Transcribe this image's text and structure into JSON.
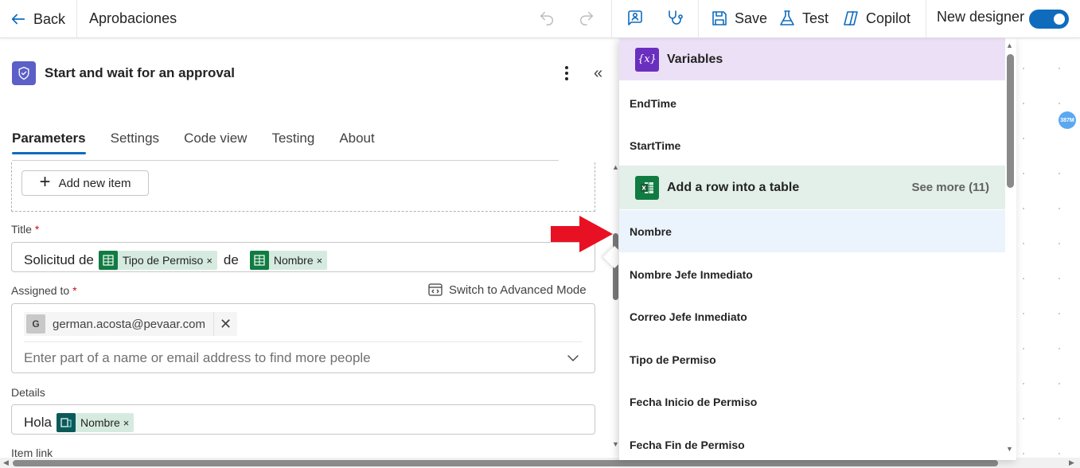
{
  "topbar": {
    "back_label": "Back",
    "flow_name": "Aprobaciones",
    "save_label": "Save",
    "test_label": "Test",
    "copilot_label": "Copilot",
    "new_designer_label": "New designer",
    "new_designer_on": true
  },
  "action": {
    "title": "Start and wait for an approval",
    "tabs": [
      {
        "label": "Parameters",
        "active": true
      },
      {
        "label": "Settings",
        "active": false
      },
      {
        "label": "Code view",
        "active": false
      },
      {
        "label": "Testing",
        "active": false
      },
      {
        "label": "About",
        "active": false
      }
    ],
    "add_item_label": "Add new item"
  },
  "fields": {
    "title_label": "Title",
    "required_mark": "*",
    "title_value": {
      "prefix": "Solicitud de",
      "token1": "Tipo de Permiso",
      "middle": "de",
      "token2": "Nombre"
    },
    "assigned_label": "Assigned to",
    "advanced_mode_label": "Switch to Advanced Mode",
    "assignee_initial": "G",
    "assignee_email": "german.acosta@pevaar.com",
    "people_placeholder": "Enter part of a name or email address to find more people",
    "details_label": "Details",
    "details_value": {
      "prefix": "Hola",
      "token": "Nombre"
    },
    "item_link_label": "Item link",
    "token_remove": "×"
  },
  "dropdown": {
    "variables_group": "Variables",
    "variables_icon_text": "{x}",
    "variables": [
      "EndTime",
      "StartTime"
    ],
    "excel_group": "Add a row into a table",
    "see_more": "See more (11)",
    "excel_items": [
      "Nombre",
      "Nombre Jefe Inmediato",
      "Correo Jefe Inmediato",
      "Tipo de Permiso",
      "Fecha Inicio de Permiso",
      "Fecha Fin de Permiso"
    ],
    "highlighted_item": "Nombre"
  },
  "canvas": {
    "badge": "387M"
  },
  "colors": {
    "accent": "#0f6cbd",
    "excel_green": "#107c41",
    "variables_purple": "#6b2fbf",
    "approval_icon": "#5b5fc7",
    "arrow_red": "#e81123"
  }
}
